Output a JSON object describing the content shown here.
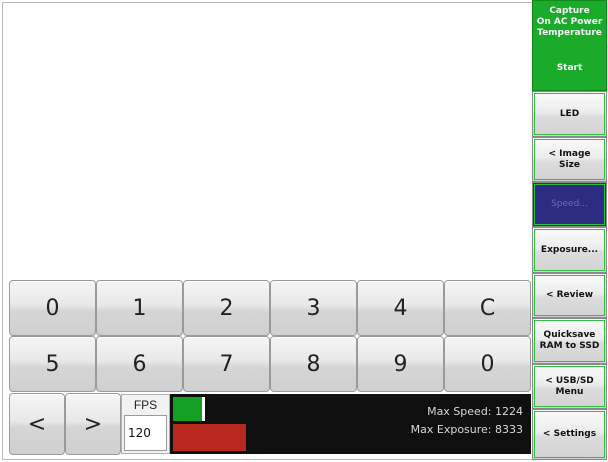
{
  "keypad": {
    "row1": [
      "0",
      "1",
      "2",
      "3",
      "4",
      "C"
    ],
    "row2": [
      "5",
      "6",
      "7",
      "8",
      "9",
      "0"
    ],
    "left_label": "<",
    "right_label": ">"
  },
  "fps": {
    "label": "FPS",
    "value": "120"
  },
  "status": {
    "max_speed": "Max Speed: 1224",
    "max_exposure": "Max Exposure: 8333"
  },
  "side_menu": {
    "capture": {
      "title_lines": [
        "Capture",
        "On AC Power",
        "Temperature"
      ],
      "action": "Start"
    },
    "led": "LED",
    "image_size": [
      "< Image",
      "Size"
    ],
    "speed": "Speed...",
    "exposure": "Exposure...",
    "review": "< Review",
    "quicksave": [
      "Quicksave",
      "RAM to SSD"
    ],
    "usb_sd": [
      "< USB/SD",
      "Menu"
    ],
    "settings": "< Settings"
  },
  "colors": {
    "accent_green": "#1bab2b",
    "speed_blue": "#2c2c82",
    "meter_green": "#14a024",
    "meter_red": "#b8281f",
    "status_bg": "#0f0f0f"
  }
}
